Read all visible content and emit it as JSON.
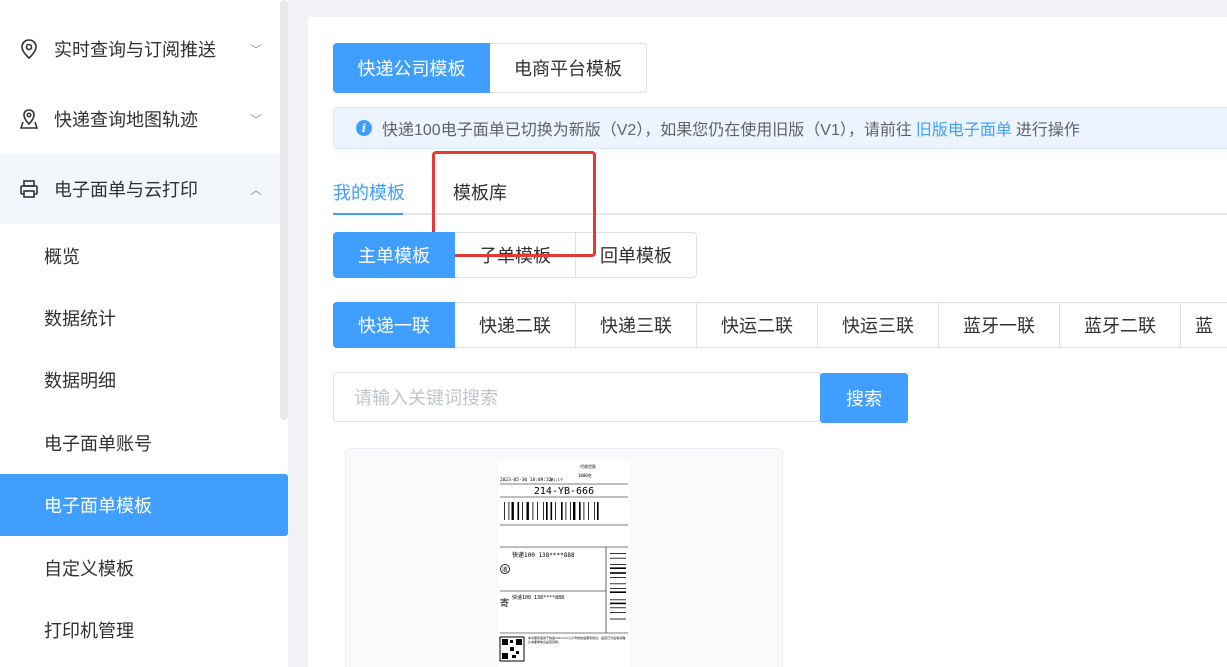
{
  "sidebar": {
    "menus": [
      {
        "label": "实时查询与订阅推送",
        "icon": "location-pin-icon"
      },
      {
        "label": "快递查询地图轨迹",
        "icon": "map-pin-icon"
      },
      {
        "label": "电子面单与云打印",
        "icon": "printer-icon"
      }
    ],
    "subitems": [
      "概览",
      "数据统计",
      "数据明细",
      "电子面单账号",
      "电子面单模板",
      "自定义模板",
      "打印机管理"
    ]
  },
  "main": {
    "top_tabs": [
      "快递公司模板",
      "电商平台模板"
    ],
    "notice": {
      "text_before": "快递100电子面单已切换为新版（V2），如果您仍在使用旧版（V1），请前往",
      "link": "旧版电子面单",
      "text_after": "进行操作"
    },
    "tabs": [
      "我的模板",
      "模板库"
    ],
    "order_types": [
      "主单模板",
      "子单模板",
      "回单模板"
    ],
    "sheet_types": [
      "快递一联",
      "快递二联",
      "快递三联",
      "快运二联",
      "快运三联",
      "蓝牙一联",
      "蓝牙二联",
      "蓝"
    ],
    "search": {
      "placeholder": "请输入关键词搜索",
      "button": "搜索"
    }
  },
  "template_preview": {
    "header_right": "代收货款",
    "date": "2023-05-30 18:09:32",
    "page": "第1/1个",
    "weight": "1000克",
    "route_code": "214-YB-666",
    "receiver": "快递100 138****888",
    "receiver_badge": "收",
    "sender": "快递100 138****888",
    "sender_badge": "寄",
    "footer_note": "本次服务适用于快递100.com公众号的快递服务协议，是否已为签收请确认本面单信息是否完整。"
  },
  "colors": {
    "primary": "#409eff",
    "highlight": "#e53935"
  }
}
